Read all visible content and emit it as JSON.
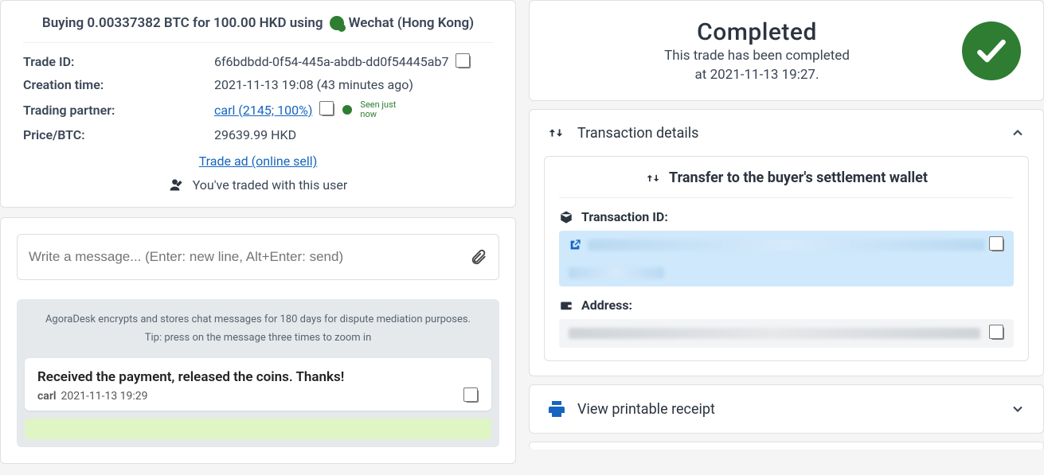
{
  "summary": {
    "title_prefix": "Buying 0.00337382 BTC for 100.00 HKD using",
    "payment_method": "Wechat (Hong Kong)"
  },
  "info": {
    "trade_id_label": "Trade ID:",
    "trade_id": "6f6bdbdd-0f54-445a-abdb-dd0f54445ab7",
    "creation_label": "Creation time:",
    "creation_value": "2021-11-13 19:08 (43 minutes ago)",
    "partner_label": "Trading partner:",
    "partner_link": "carl (2145; 100%)",
    "seen_text": "Seen just now",
    "price_label": "Price/BTC:",
    "price_value": "29639.99 HKD",
    "trade_ad_link": "Trade ad (online sell)",
    "traded_with": "You've traded with this user"
  },
  "chat": {
    "placeholder": "Write a message... (Enter: new line, Alt+Enter: send)",
    "notice": "AgoraDesk encrypts and stores chat messages for 180 days for dispute mediation purposes.",
    "tip": "Tip: press on the message three times to zoom in",
    "msg_text": "Received the payment, released the coins. Thanks!",
    "msg_name": "carl",
    "msg_time": "2021-11-13 19:29"
  },
  "status": {
    "title": "Completed",
    "subtitle": "This trade has been completed",
    "time": "at 2021-11-13 19:27."
  },
  "tx": {
    "header": "Transaction details",
    "panel_title": "Transfer to the buyer's settlement wallet",
    "txid_label": "Transaction ID:",
    "address_label": "Address:"
  },
  "receipt": {
    "label": "View printable receipt"
  }
}
